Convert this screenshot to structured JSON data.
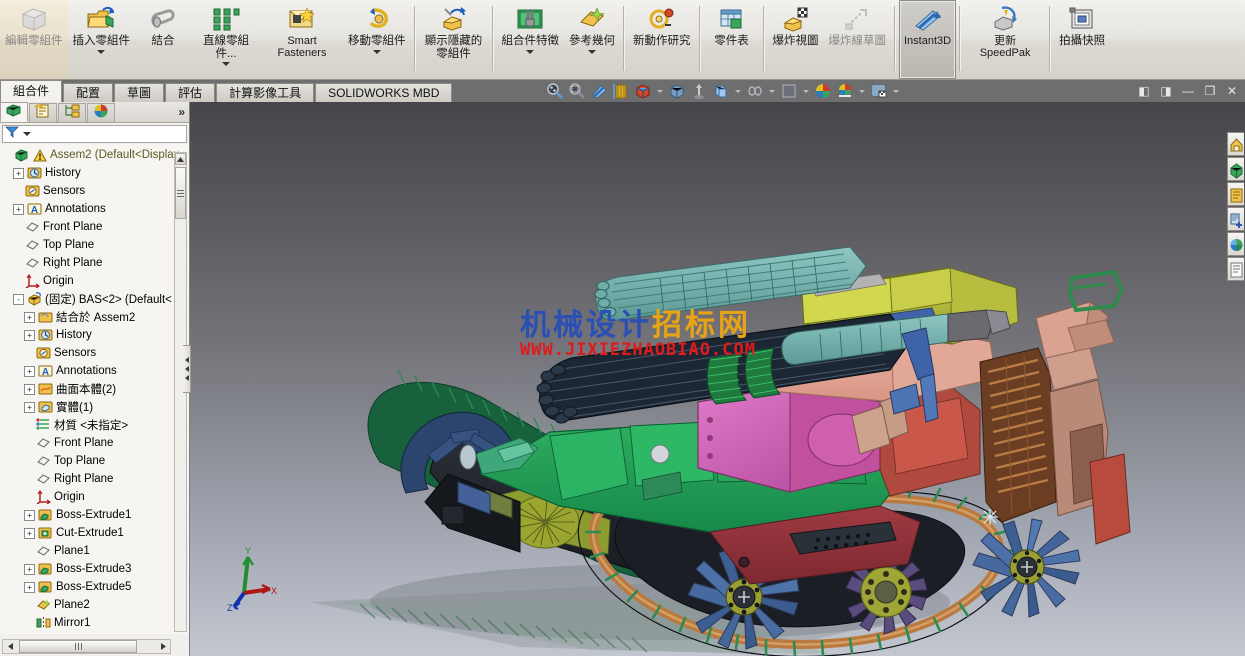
{
  "ribbon": {
    "items": [
      {
        "label": "編輯零組件",
        "icon": "edit-component-icon",
        "caret": false,
        "disabled": true,
        "latin": false
      },
      {
        "label": "插入零組件",
        "icon": "insert-component-icon",
        "caret": true,
        "disabled": false,
        "latin": false
      },
      {
        "label": "結合",
        "icon": "mate-icon",
        "caret": false,
        "disabled": false,
        "latin": false
      },
      {
        "label": "直線零組件...",
        "icon": "linear-pattern-icon",
        "caret": true,
        "disabled": false,
        "latin": false
      },
      {
        "label": "Smart Fasteners",
        "icon": "smart-fasteners-icon",
        "caret": false,
        "disabled": false,
        "latin": true
      },
      {
        "label": "移動零組件",
        "icon": "move-component-icon",
        "caret": true,
        "disabled": false,
        "latin": false
      },
      {
        "sep": true
      },
      {
        "label": "顯示隱藏的零組件",
        "icon": "show-hidden-components-icon",
        "caret": false,
        "disabled": false,
        "latin": false
      },
      {
        "sep": true
      },
      {
        "label": "組合件特徵",
        "icon": "assembly-features-icon",
        "caret": true,
        "disabled": false,
        "latin": false
      },
      {
        "label": "參考幾何",
        "icon": "reference-geometry-icon",
        "caret": true,
        "disabled": false,
        "latin": false
      },
      {
        "sep": true
      },
      {
        "label": "新動作研究",
        "icon": "new-motion-study-icon",
        "caret": false,
        "disabled": false,
        "latin": false
      },
      {
        "sep": true
      },
      {
        "label": "零件表",
        "icon": "bill-of-materials-icon",
        "caret": false,
        "disabled": false,
        "latin": false
      },
      {
        "sep": true
      },
      {
        "label": "爆炸視圖",
        "icon": "exploded-view-icon",
        "caret": false,
        "disabled": false,
        "latin": false
      },
      {
        "label": "爆炸線草圖",
        "icon": "explode-line-sketch-icon",
        "caret": false,
        "disabled": true,
        "latin": false
      },
      {
        "sep": true
      },
      {
        "label": "Instant3D",
        "icon": "instant3d-icon",
        "caret": false,
        "disabled": false,
        "latin": true,
        "active": true
      },
      {
        "sep": true
      },
      {
        "label": "更新 SpeedPak",
        "icon": "update-speedpak-icon",
        "caret": false,
        "disabled": false,
        "latin": true
      },
      {
        "sep": true
      },
      {
        "label": "拍攝快照",
        "icon": "capture-snapshot-icon",
        "caret": false,
        "disabled": false,
        "latin": false
      }
    ]
  },
  "command_tabs": {
    "items": [
      {
        "label": "組合件",
        "selected": true
      },
      {
        "label": "配置",
        "selected": false
      },
      {
        "label": "草圖",
        "selected": false
      },
      {
        "label": "評估",
        "selected": false
      },
      {
        "label": "計算影像工具",
        "selected": false
      },
      {
        "label": "SOLIDWORKS MBD",
        "selected": false
      }
    ]
  },
  "view_toolbar": {
    "items": [
      {
        "name": "zoom-to-fit-icon",
        "caret": false
      },
      {
        "name": "zoom-to-area-icon",
        "caret": false
      },
      {
        "name": "previous-view-icon",
        "caret": false
      },
      {
        "name": "section-view-icon",
        "caret": false
      },
      {
        "name": "view-orientation-icon",
        "caret": true
      },
      {
        "name": "display-style-icon",
        "caret": false
      },
      {
        "name": "hide-show-items-icon",
        "caret": false
      },
      {
        "name": "edit-appearance-icon",
        "caret": true
      },
      {
        "name": "apply-scene-icon",
        "caret": true
      },
      {
        "name": "view-settings-icon",
        "caret": true
      },
      {
        "name": "appearances-icon",
        "caret": false
      },
      {
        "name": "scene-icon",
        "caret": true
      },
      {
        "name": "viewport-layout-icon",
        "caret": true
      }
    ]
  },
  "window_controls": {
    "items": [
      {
        "name": "restore-left-icon",
        "glyph": "◧"
      },
      {
        "name": "restore-right-icon",
        "glyph": "◨"
      },
      {
        "name": "minimize-icon",
        "glyph": "—"
      },
      {
        "name": "maximize-icon",
        "glyph": "❐"
      },
      {
        "name": "close-icon",
        "glyph": "✕"
      }
    ]
  },
  "left_panel": {
    "tabs": [
      {
        "name": "feature-manager-tab",
        "icon": "feature-tree-icon",
        "selected": true
      },
      {
        "name": "property-manager-tab",
        "icon": "property-manager-icon",
        "selected": false
      },
      {
        "name": "configuration-manager-tab",
        "icon": "configuration-manager-icon",
        "selected": false
      },
      {
        "name": "display-manager-tab",
        "icon": "display-manager-icon",
        "selected": false
      }
    ],
    "more_glyph": "»",
    "filter": {
      "icon": "filter-icon",
      "placeholder": ""
    },
    "tree": [
      {
        "depth": 0,
        "toggle": "none",
        "icon": "assembly-icon",
        "warn": true,
        "label": "Assem2  (Default<Display",
        "style": "root"
      },
      {
        "depth": 1,
        "toggle": "+",
        "icon": "history-icon",
        "label": "History"
      },
      {
        "depth": 1,
        "toggle": "none",
        "icon": "sensors-icon",
        "label": "Sensors"
      },
      {
        "depth": 1,
        "toggle": "+",
        "icon": "annotations-icon",
        "label": "Annotations"
      },
      {
        "depth": 1,
        "toggle": "none",
        "icon": "plane-icon",
        "label": "Front Plane"
      },
      {
        "depth": 1,
        "toggle": "none",
        "icon": "plane-icon",
        "label": "Top Plane"
      },
      {
        "depth": 1,
        "toggle": "none",
        "icon": "plane-icon",
        "label": "Right Plane"
      },
      {
        "depth": 1,
        "toggle": "none",
        "icon": "origin-icon",
        "label": "Origin"
      },
      {
        "depth": 1,
        "toggle": "-",
        "icon": "component-icon",
        "label": "(固定) BAS<2> (Default<"
      },
      {
        "depth": 2,
        "toggle": "+",
        "icon": "mates-folder-icon",
        "label": "結合於 Assem2"
      },
      {
        "depth": 2,
        "toggle": "+",
        "icon": "history-icon",
        "label": "History"
      },
      {
        "depth": 2,
        "toggle": "none",
        "icon": "sensors-icon",
        "label": "Sensors"
      },
      {
        "depth": 2,
        "toggle": "+",
        "icon": "annotations-icon",
        "label": "Annotations"
      },
      {
        "depth": 2,
        "toggle": "+",
        "icon": "surface-bodies-icon",
        "label": "曲面本體(2)"
      },
      {
        "depth": 2,
        "toggle": "+",
        "icon": "solid-bodies-icon",
        "label": "實體(1)"
      },
      {
        "depth": 2,
        "toggle": "none",
        "icon": "material-icon",
        "label": "材質 <未指定>"
      },
      {
        "depth": 2,
        "toggle": "none",
        "icon": "plane-icon",
        "label": "Front Plane"
      },
      {
        "depth": 2,
        "toggle": "none",
        "icon": "plane-icon",
        "label": "Top Plane"
      },
      {
        "depth": 2,
        "toggle": "none",
        "icon": "plane-icon",
        "label": "Right Plane"
      },
      {
        "depth": 2,
        "toggle": "none",
        "icon": "origin-icon",
        "label": "Origin"
      },
      {
        "depth": 2,
        "toggle": "+",
        "icon": "boss-extrude-icon",
        "label": "Boss-Extrude1"
      },
      {
        "depth": 2,
        "toggle": "+",
        "icon": "cut-extrude-icon",
        "label": "Cut-Extrude1"
      },
      {
        "depth": 2,
        "toggle": "none",
        "icon": "plane-icon",
        "label": "Plane1"
      },
      {
        "depth": 2,
        "toggle": "+",
        "icon": "boss-extrude-icon",
        "label": "Boss-Extrude3"
      },
      {
        "depth": 2,
        "toggle": "+",
        "icon": "boss-extrude-icon",
        "label": "Boss-Extrude5"
      },
      {
        "depth": 2,
        "toggle": "none",
        "icon": "plane-gold-icon",
        "label": "Plane2"
      },
      {
        "depth": 2,
        "toggle": "none",
        "icon": "mirror-icon",
        "label": "Mirror1"
      }
    ]
  },
  "task_pane": {
    "items": [
      {
        "name": "solidworks-resources-icon"
      },
      {
        "name": "design-library-icon"
      },
      {
        "name": "file-explorer-icon"
      },
      {
        "name": "view-palette-icon"
      },
      {
        "name": "appearances-scenes-icon"
      },
      {
        "name": "custom-properties-icon"
      }
    ]
  },
  "viewport": {
    "watermark": {
      "line1_blue": "机械设计",
      "line1_orange": "招标网",
      "line2": "WWW.JIXIEZHAOBIAO.COM"
    },
    "triad": {
      "x_label": "X",
      "y_label": "Y",
      "z_label": "Z"
    },
    "model_description": "Tracked robotic vehicle assembly with multi-barrel gatling gun turret",
    "background_top_color": "#46464a",
    "background_bottom_color": "#c2c6ce"
  }
}
